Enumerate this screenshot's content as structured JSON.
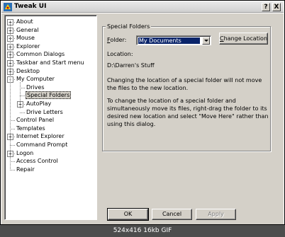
{
  "window": {
    "title": "Tweak UI"
  },
  "titlebar_buttons": {
    "help": "?",
    "close": "X"
  },
  "tree": {
    "items": [
      {
        "label": "About",
        "expander": "+",
        "level": 0
      },
      {
        "label": "General",
        "expander": "+",
        "level": 0
      },
      {
        "label": "Mouse",
        "expander": "+",
        "level": 0
      },
      {
        "label": "Explorer",
        "expander": "+",
        "level": 0
      },
      {
        "label": "Common Dialogs",
        "expander": "+",
        "level": 0
      },
      {
        "label": "Taskbar and Start menu",
        "expander": "+",
        "level": 0
      },
      {
        "label": "Desktop",
        "expander": "+",
        "level": 0
      },
      {
        "label": "My Computer",
        "expander": "-",
        "level": 0
      },
      {
        "label": "Drives",
        "expander": "",
        "level": 1
      },
      {
        "label": "Special Folders",
        "expander": "",
        "level": 1,
        "selected": true
      },
      {
        "label": "AutoPlay",
        "expander": "+",
        "level": 1
      },
      {
        "label": "Drive Letters",
        "expander": "",
        "level": 1
      },
      {
        "label": "Control Panel",
        "expander": "",
        "level": 0
      },
      {
        "label": "Templates",
        "expander": "",
        "level": 0
      },
      {
        "label": "Internet Explorer",
        "expander": "+",
        "level": 0
      },
      {
        "label": "Command Prompt",
        "expander": "",
        "level": 0
      },
      {
        "label": "Logon",
        "expander": "+",
        "level": 0
      },
      {
        "label": "Access Control",
        "expander": "",
        "level": 0
      },
      {
        "label": "Repair",
        "expander": "",
        "level": 0
      }
    ]
  },
  "panel": {
    "group_title": "Special Folders",
    "folder_label_u": "F",
    "folder_label_rest": "older:",
    "folder_value": "My Documents",
    "change_location_u": "C",
    "change_location_rest": "hange Location",
    "location_label": "Location:",
    "location_value": "D:\\Darren's Stuff",
    "para1": "Changing the location of a special folder will not move the files to the new location.",
    "para2": "To change the location of a special folder and simultaneously move its files, right-drag the folder to its desired new location and select \"Move Here\" rather than using this dialog."
  },
  "buttons": {
    "ok": "OK",
    "cancel": "Cancel",
    "apply": "Apply"
  },
  "footer": {
    "caption": "524x416 16kb GIF"
  }
}
